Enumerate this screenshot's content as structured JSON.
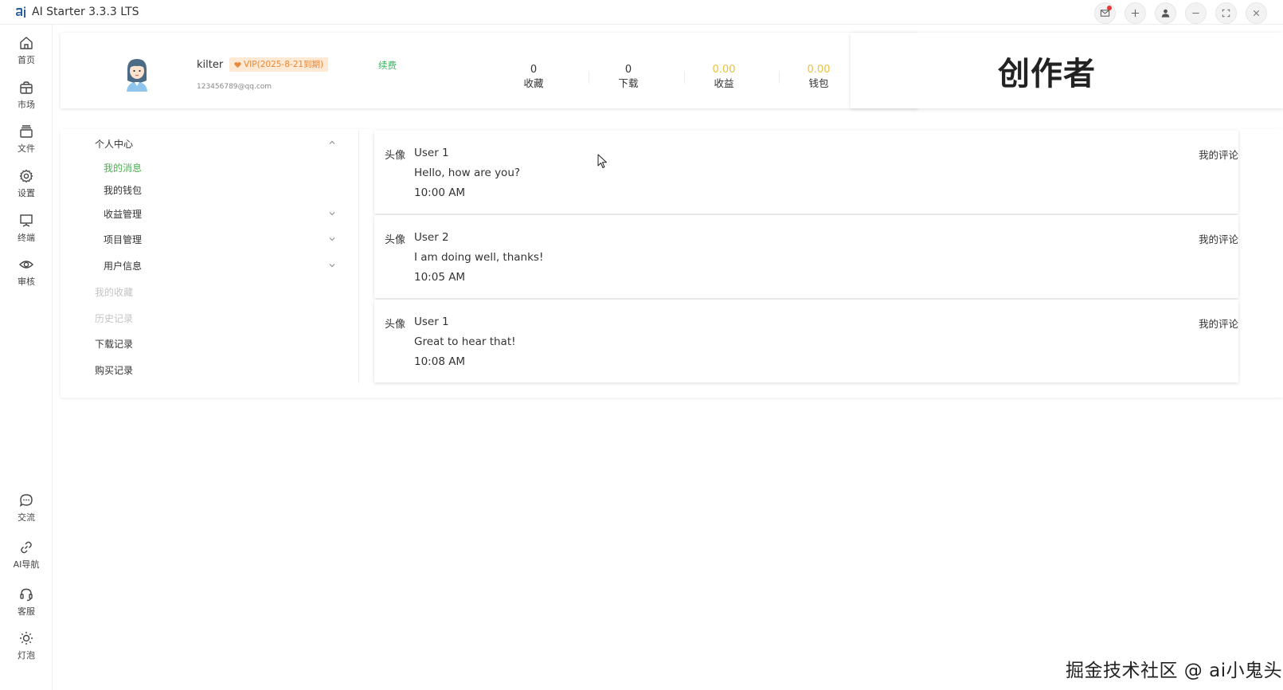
{
  "window": {
    "title": "AI Starter 3.3.3 LTS"
  },
  "rail": {
    "top_items": [
      {
        "label": "首页",
        "icon": "home-icon"
      },
      {
        "label": "市场",
        "icon": "shop-icon"
      },
      {
        "label": "文件",
        "icon": "files-icon"
      },
      {
        "label": "设置",
        "icon": "gear-icon"
      },
      {
        "label": "终端",
        "icon": "terminal-icon"
      },
      {
        "label": "审核",
        "icon": "eye-icon"
      }
    ],
    "bottom_items": [
      {
        "label": "交流",
        "icon": "chat-icon"
      },
      {
        "label": "AI导航",
        "icon": "link-icon"
      },
      {
        "label": "客服",
        "icon": "headset-icon"
      },
      {
        "label": "灯泡",
        "icon": "bulb-icon"
      }
    ]
  },
  "profile": {
    "username": "kilter",
    "vip": "VIP(2025-8-21到期)",
    "renew": "续费",
    "email": "123456789@qq.com",
    "stats": [
      {
        "value": "0",
        "label": "收藏"
      },
      {
        "value": "0",
        "label": "下载"
      },
      {
        "value": "0.00",
        "label": "收益"
      },
      {
        "value": "0.00",
        "label": "钱包"
      }
    ]
  },
  "creator": {
    "title": "创作者"
  },
  "menu": {
    "personal_center": "个人中心",
    "my_messages": "我的消息",
    "my_wallet": "我的钱包",
    "revenue_management": "收益管理",
    "project_management": "项目管理",
    "user_info": "用户信息",
    "my_favorites": "我的收藏",
    "history": "历史记录",
    "download_records": "下载记录",
    "purchase_records": "购买记录"
  },
  "messages": [
    {
      "avatar": "头像",
      "user": "User 1",
      "text": "Hello, how are you?",
      "time": "10:00 AM",
      "link": "我的评论"
    },
    {
      "avatar": "头像",
      "user": "User 2",
      "text": "I am doing well, thanks!",
      "time": "10:05 AM",
      "link": "我的评论"
    },
    {
      "avatar": "头像",
      "user": "User 1",
      "text": "Great to hear that!",
      "time": "10:08 AM",
      "link": "我的评论"
    }
  ],
  "watermark": "掘金技术社区 @ ai小鬼头",
  "colors": {
    "active_green": "#4caf50",
    "renew_green": "#3bb55e",
    "gold": "#e7c23f",
    "vip_bg": "#fde9d4",
    "vip_text": "#e8883a"
  }
}
